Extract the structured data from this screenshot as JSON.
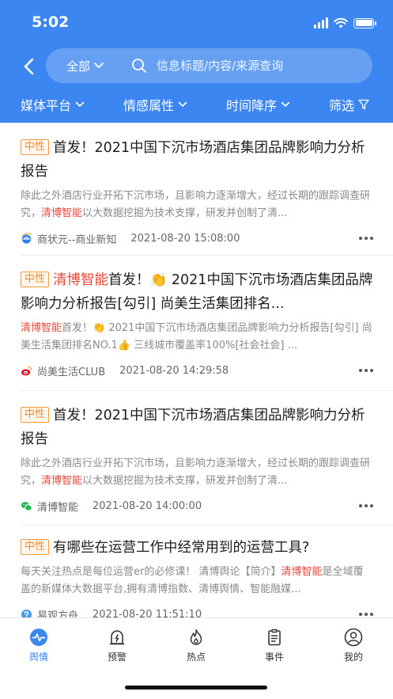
{
  "status_bar": {
    "time": "5:02"
  },
  "search": {
    "scope": "全部",
    "placeholder": "信息标题/内容/来源查询"
  },
  "filters": [
    {
      "label": "媒体平台"
    },
    {
      "label": "情感属性"
    },
    {
      "label": "时间降序"
    },
    {
      "label": "筛选"
    }
  ],
  "articles": [
    {
      "tag": "中性",
      "title_pre": "",
      "title_hl": "",
      "title_post": "首发！2021中国下沉市场酒店集团品牌影响力分析报告",
      "summary_pre": "除此之外酒店行业开拓下沉市场，且影响力逐渐增大，经过长期的跟踪调查研究，",
      "summary_hl": "清博智能",
      "summary_post": "以大数据挖掘为技术支撑，研发并创制了清...",
      "source": "商状元--商业新知",
      "time": "2021-08-20 15:08:00",
      "source_icon": "ie-browser-icon"
    },
    {
      "tag": "中性",
      "title_pre": "",
      "title_hl": "清博智能",
      "title_post": "首发！👏 2021中国下沉市场酒店集团品牌影响力分析报告[勾引] 尚美生活集团排名...",
      "summary_pre": "",
      "summary_hl": "清博智能",
      "summary_post": "首发！👏 2021中国下沉市场酒店集团品牌影响力分析报告[勾引] 尚美生活集团排名NO.1👍 三线城市覆盖率100%[社会社会] ...",
      "source": "尚美生活CLUB",
      "time": "2021-08-20 14:29:58",
      "source_icon": "weibo-icon"
    },
    {
      "tag": "中性",
      "title_pre": "",
      "title_hl": "",
      "title_post": "首发！2021中国下沉市场酒店集团品牌影响力分析报告",
      "summary_pre": "除此之外酒店行业开拓下沉市场，且影响力逐渐增大，经过长期的跟踪调查研究，",
      "summary_hl": "清博智能",
      "summary_post": "以大数据挖掘为技术支撑，研发并创制了清...",
      "source": "清博智能",
      "time": "2021-08-20 14:00:00",
      "source_icon": "wechat-icon"
    },
    {
      "tag": "中性",
      "title_pre": "",
      "title_hl": "",
      "title_post": "有哪些在运营工作中经常用到的运营工具?",
      "summary_pre": "每天关注热点是每位运营er的必修课！ 清博舆论【简介】",
      "summary_hl": "清博智能",
      "summary_post": "是全域覆盖的新媒体大数据平台,拥有清博指数、清博舆情、智能融媒...",
      "source": "易观方舟",
      "time": "2021-08-20 11:51:10",
      "source_icon": "question-circle-icon"
    }
  ],
  "tabbar": [
    {
      "label": "舆情",
      "icon": "pulse-icon",
      "active": true
    },
    {
      "label": "预警",
      "icon": "alarm-icon",
      "active": false
    },
    {
      "label": "热点",
      "icon": "flame-icon",
      "active": false
    },
    {
      "label": "事件",
      "icon": "clipboard-icon",
      "active": false
    },
    {
      "label": "我的",
      "icon": "user-icon",
      "active": false
    }
  ],
  "colors": {
    "primary": "#3b86f0",
    "highlight": "#e8473a",
    "tag": "#f08a2a"
  }
}
